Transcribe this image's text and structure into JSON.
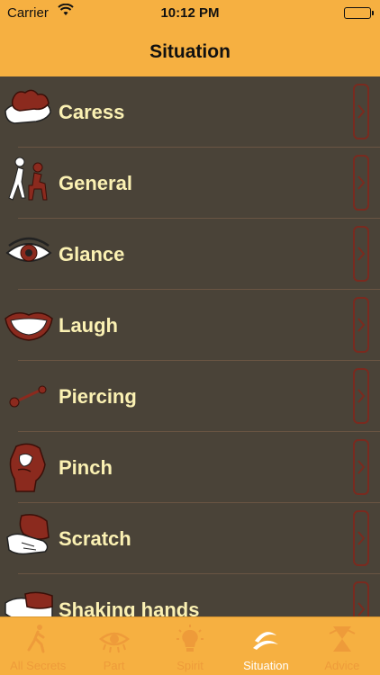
{
  "status": {
    "carrier": "Carrier",
    "time": "10:12 PM"
  },
  "nav": {
    "title": "Situation"
  },
  "items": [
    {
      "label": "Caress",
      "icon": "caress-hand-icon"
    },
    {
      "label": "General",
      "icon": "people-icon"
    },
    {
      "label": "Glance",
      "icon": "eye-icon"
    },
    {
      "label": "Laugh",
      "icon": "mouth-icon"
    },
    {
      "label": "Piercing",
      "icon": "piercing-icon"
    },
    {
      "label": "Pinch",
      "icon": "pinch-hand-icon"
    },
    {
      "label": "Scratch",
      "icon": "scratch-hand-icon"
    },
    {
      "label": "Shaking hands",
      "icon": "handshake-icon"
    }
  ],
  "tabs": [
    {
      "label": "All Secrets",
      "icon": "walking-person-icon",
      "active": false
    },
    {
      "label": "Part",
      "icon": "eye-lash-icon",
      "active": false
    },
    {
      "label": "Spirit",
      "icon": "lightbulb-icon",
      "active": false
    },
    {
      "label": "Situation",
      "icon": "swirl-icon",
      "active": true
    },
    {
      "label": "Advice",
      "icon": "hourglass-icon",
      "active": false
    }
  ],
  "colors": {
    "accent": "#f6b041",
    "background": "#4a4338",
    "label": "#fbf1b3",
    "icon_red": "#8b2a1e",
    "tab_inactive": "#ee9b3a",
    "tab_active": "#ffffff"
  }
}
